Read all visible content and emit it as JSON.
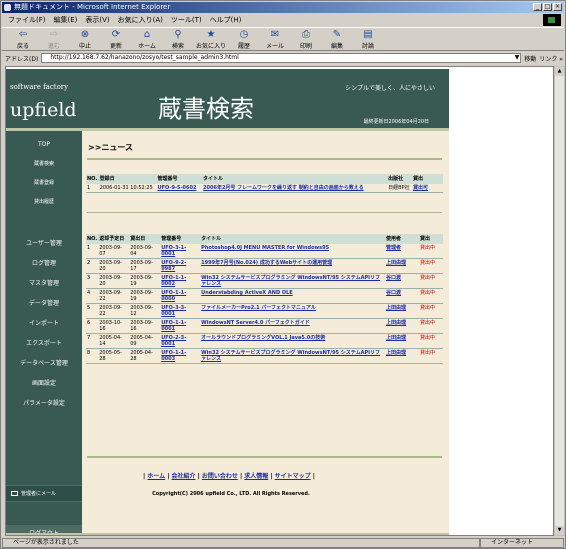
{
  "window": {
    "title": "無題ドキュメント - Microsoft Internet Explorer"
  },
  "menu": [
    "ファイル(F)",
    "編集(E)",
    "表示(V)",
    "お気に入り(A)",
    "ツール(T)",
    "ヘルプ(H)"
  ],
  "toolbar": [
    {
      "label": "戻る",
      "icon": "back-icon",
      "glyph": "⇦",
      "enabled": true
    },
    {
      "label": "進む",
      "icon": "forward-icon",
      "glyph": "⇨",
      "enabled": false
    },
    {
      "label": "中止",
      "icon": "stop-icon",
      "glyph": "⊗",
      "enabled": true
    },
    {
      "label": "更新",
      "icon": "refresh-icon",
      "glyph": "⟳",
      "enabled": true
    },
    {
      "label": "ホーム",
      "icon": "home-icon",
      "glyph": "⌂",
      "enabled": true
    },
    {
      "label": "検索",
      "icon": "search-icon",
      "glyph": "⚲",
      "enabled": true
    },
    {
      "label": "お気に入り",
      "icon": "favorites-icon",
      "glyph": "★",
      "enabled": true
    },
    {
      "label": "履歴",
      "icon": "history-icon",
      "glyph": "◷",
      "enabled": true
    },
    {
      "label": "メール",
      "icon": "mail-icon",
      "glyph": "✉",
      "enabled": true
    },
    {
      "label": "印刷",
      "icon": "print-icon",
      "glyph": "⎙",
      "enabled": true
    },
    {
      "label": "編集",
      "icon": "edit-icon",
      "glyph": "✎",
      "enabled": true
    },
    {
      "label": "討論",
      "icon": "discuss-icon",
      "glyph": "▤",
      "enabled": true
    }
  ],
  "address": {
    "label": "アドレス(D)",
    "url": "http://192.168.7.62/hanazono/zosyo/test_sample_admin3.html",
    "go": "移動",
    "links": "リンク »"
  },
  "status": {
    "text": "ページが表示されました",
    "zone": "インターネット"
  },
  "site": {
    "sf": "software factory",
    "brand": "upfield",
    "title": "蔵書検索",
    "tagline": "シンプルで美しく、人にやさしい",
    "updated": "最終更新日2006年04月20日"
  },
  "nav": [
    "TOP",
    "蔵書検索",
    "蔵書登録",
    "貸出履歴",
    "ユーザー管理",
    "ログ管理",
    "マスタ管理",
    "データ管理",
    "インポート",
    "エクスポート",
    "データベース管理",
    "画面設定",
    "パラメータ設定"
  ],
  "mail": "管理者にメール",
  "logout": "ログアウト",
  "news_heading": ">>ニュース",
  "news_table": {
    "headers": [
      "NO.",
      "登録日",
      "管理番号",
      "タイトル",
      "出版社",
      "貸出"
    ],
    "rows": [
      [
        "1",
        "2006-01-31 10:52:25",
        "UFO-9-5-0602",
        "2006年2月号 フレームワークを繰り返す 制約と自由の画面から教える",
        "日経BP社",
        "貸出可"
      ]
    ]
  },
  "loan_table": {
    "headers": [
      "NO.",
      "返却予定日",
      "貸出日",
      "管理番号",
      "タイトル",
      "使用者",
      "貸出"
    ],
    "rows": [
      [
        "1",
        "2003-09-07",
        "2003-09-04",
        "UFO-3-1-0001",
        "Photoshop4.0J MENU MASTER for Windows95",
        "管理者",
        "貸出中"
      ],
      [
        "2",
        "2003-09-20",
        "2003-09-17",
        "UFO-9-2-9987",
        "1999年7月号(No.024) 成功するWebサイトの運用管理",
        "上田由理",
        "貸出中"
      ],
      [
        "3",
        "2003-09-20",
        "2003-09-19",
        "UFO-1-1-0002",
        "Win32 システムサービスプログラミング WindowsNT/95 システムAPIリファレンス",
        "谷口渡",
        "貸出中"
      ],
      [
        "4",
        "2003-09-22",
        "2003-09-19",
        "UFO-1-1-0000",
        "Understabding ActiveX AND OLE",
        "谷口渡",
        "貸出中"
      ],
      [
        "5",
        "2003-09-22",
        "2003-09-12",
        "UFO-3-3-0001",
        "ファイルメーカーPro2.1 パーフェクトマニュアル",
        "上田由理",
        "貸出中"
      ],
      [
        "6",
        "2003-10-16",
        "2003-09-16",
        "UFO-1-1-0001",
        "WindowsNT Server4.0 パーフェクトガイド",
        "上田由理",
        "貸出中"
      ],
      [
        "7",
        "2005-04-14",
        "2005-04-09",
        "UFO-2-3-0001",
        "オールラウンドプログラミングVOL.1 Java5.0の技術",
        "上田由理",
        "貸出中"
      ],
      [
        "8",
        "2005-05-28",
        "2005-04-28",
        "UFO-1-1-0003",
        "Win32 システムサービスプログラミング WindowsNT/95 システムAPIリファレンス",
        "上田由理",
        "貸出中"
      ]
    ]
  },
  "footer": {
    "links": [
      "ホーム",
      "会社紹介",
      "お問い合わせ",
      "求人情報",
      "サイトマップ"
    ],
    "copyright": "Copyright(C) 2006 upfield Co., LTD. All Rights Reserved."
  }
}
